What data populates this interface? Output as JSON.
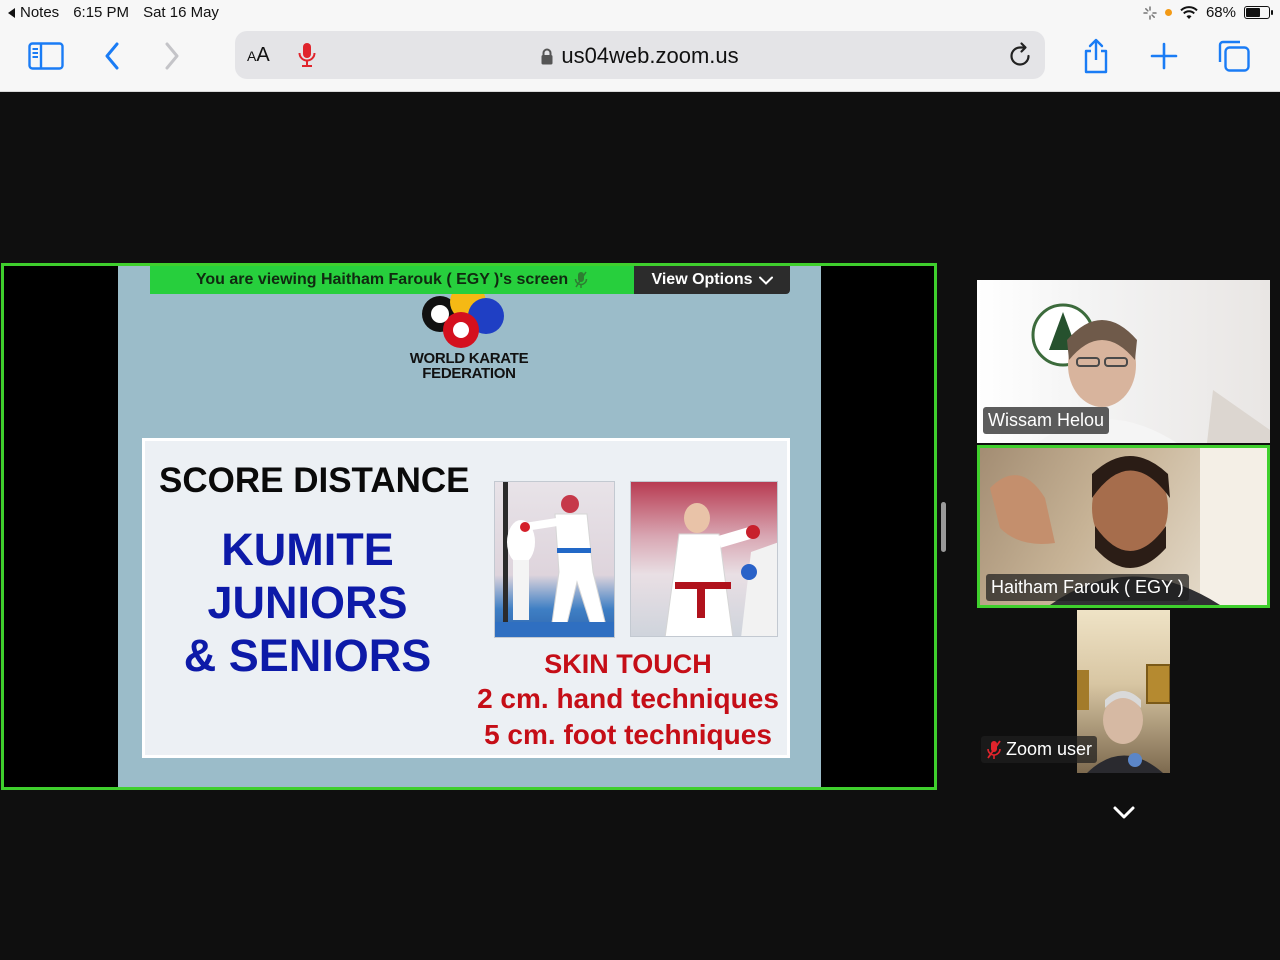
{
  "status_bar": {
    "back_app": "Notes",
    "time": "6:15 PM",
    "date": "Sat 16 May",
    "battery": "68%",
    "battery_level": 0.68
  },
  "browser": {
    "reader_label": "AA",
    "url": "us04web.zoom.us",
    "icons": [
      "sidebar-icon",
      "back-icon",
      "forward-icon",
      "microphone-icon",
      "lock-icon",
      "reload-icon",
      "share-icon",
      "new-tab-icon",
      "tabs-icon"
    ]
  },
  "meeting": {
    "viewing_banner": "You are viewing  Haitham Farouk ( EGY )'s screen",
    "view_options": "View Options",
    "slide": {
      "logo_line1": "WORLD KARATE",
      "logo_line2": "FEDERATION",
      "title": "SCORE DISTANCE",
      "kumite_line1": "KUMITE",
      "kumite_line2": "JUNIORS",
      "kumite_line3": "& SENIORS",
      "rule_line1": "SKIN TOUCH",
      "rule_line2": "2 cm. hand techniques",
      "rule_line3": "5 cm. foot techniques"
    },
    "participants": [
      {
        "name": "Wissam Helou",
        "muted": false,
        "active_speaker": false
      },
      {
        "name": "Haitham Farouk ( EGY )",
        "muted": false,
        "active_speaker": true
      },
      {
        "name": "Zoom user",
        "muted": true,
        "active_speaker": false
      }
    ]
  },
  "colors": {
    "active_green": "#3fcf2d",
    "banner_green": "#27cf3d",
    "slide_blue_text": "#0d1aa8",
    "slide_red_text": "#c50e17",
    "system_blue": "#1a7cf5"
  }
}
